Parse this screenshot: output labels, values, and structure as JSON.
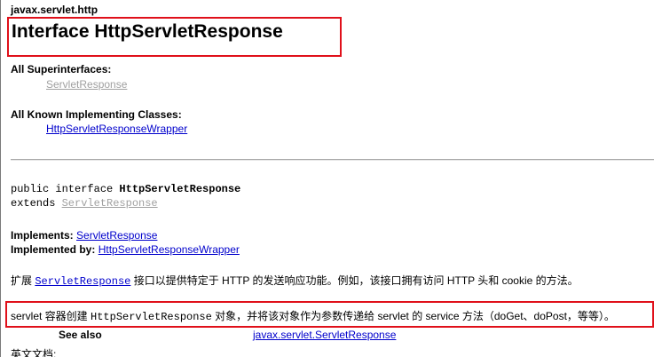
{
  "package_name": "javax.servlet.http",
  "title": "Interface HttpServletResponse",
  "superinterfaces": {
    "label": "All Superinterfaces:",
    "link": "ServletResponse"
  },
  "implementing_classes": {
    "label": "All Known Implementing Classes:",
    "link": "HttpServletResponseWrapper"
  },
  "declaration": {
    "prefix": "public interface ",
    "name": "HttpServletResponse",
    "extends_keyword": "extends ",
    "extends_link": "ServletResponse"
  },
  "implements": {
    "label": "Implements:",
    "link": "ServletResponse"
  },
  "implemented_by": {
    "label": "Implemented by:",
    "link": "HttpServletResponseWrapper"
  },
  "description_1": {
    "prefix": "扩展 ",
    "code_link": "ServletResponse",
    "suffix": " 接口以提供特定于 HTTP 的发送响应功能。例如，该接口拥有访问 HTTP 头和 cookie 的方法。"
  },
  "description_2": {
    "prefix": "servlet 容器创建 ",
    "code": "HttpServletResponse",
    "suffix": " 对象，并将该对象作为参数传递给 servlet 的 service 方法（doGet、doPost，等等）。"
  },
  "see_also": {
    "label": "See also",
    "link": "javax.servlet.ServletResponse"
  },
  "english_doc_label": "英文文档:",
  "colors": {
    "link": "#0000cc",
    "visited_link": "#a0a0a0",
    "highlight_box": "#e0101a"
  }
}
